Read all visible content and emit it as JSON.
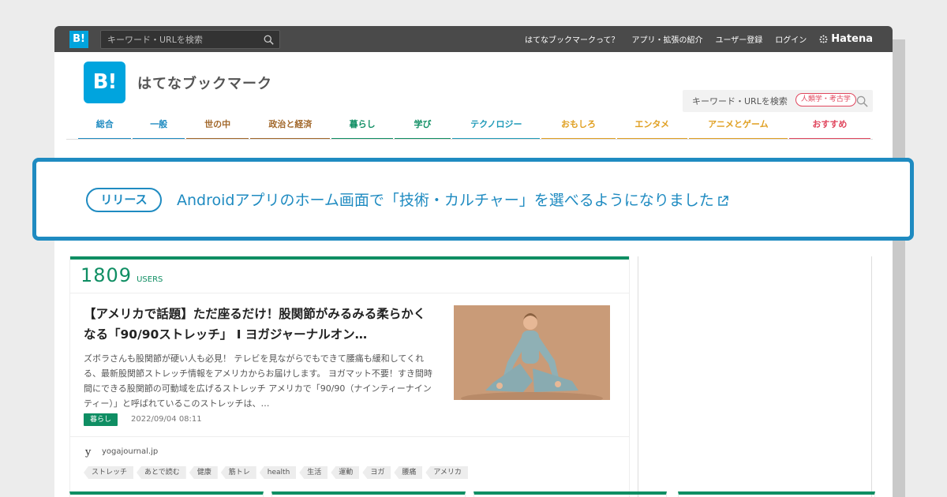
{
  "topbar": {
    "logo": "B!",
    "search_placeholder": "キーワード・URLを検索",
    "nav": [
      "はてなブックマークって？",
      "アプリ・拡張の紹介",
      "ユーザー登録",
      "ログイン"
    ],
    "hatena_logo": "Hatena"
  },
  "header": {
    "logo": "B!",
    "brand": "はてなブックマーク",
    "search_placeholder": "キーワード・URLを検索"
  },
  "categories": [
    {
      "label": "総合",
      "color": "#1f8bc1"
    },
    {
      "label": "一般",
      "color": "#1f8bc1"
    },
    {
      "label": "世の中",
      "color": "#a2682b"
    },
    {
      "label": "政治と経済",
      "color": "#a2682b"
    },
    {
      "label": "暮らし",
      "color": "#0f8e63"
    },
    {
      "label": "学び",
      "color": "#0f8e63"
    },
    {
      "label": "テクノロジー",
      "color": "#1f9ab8"
    },
    {
      "label": "おもしろ",
      "color": "#e0a022"
    },
    {
      "label": "エンタメ",
      "color": "#e0a022"
    },
    {
      "label": "アニメとゲーム",
      "color": "#e0a022"
    },
    {
      "label": "おすすめ",
      "color": "#e0475e"
    }
  ],
  "recommend_badge": "人類学・考古学",
  "announcement": {
    "tag": "リリース",
    "message": "Androidアプリのホーム画面で「技術・カルチャー」を選べるようになりました"
  },
  "entry": {
    "users_count": "1809",
    "users_label": "USERS",
    "title": "【アメリカで話題】ただ座るだけ！股関節がみるみる柔らかくなる「90/90ストレッチ」 I ヨガジャーナルオン…",
    "summary": "ズボラさんも股関節が硬い人も必見！ テレビを見ながらでもできて腰痛も緩和してくれる、最新股関節ストレッチ情報をアメリカからお届けします。 ヨガマット不要！すき間時間にできる股関節の可動域を広げるストレッチ アメリカで「90/90（ナインティーナインティー）」と呼ばれているこのストレッチは、…",
    "category": "暮らし",
    "date": "2022/09/04 08:11",
    "favicon": "y",
    "domain": "yogajournal.jp",
    "tags": [
      "ストレッチ",
      "あとで読む",
      "健康",
      "筋トレ",
      "health",
      "生活",
      "運動",
      "ヨガ",
      "腰痛",
      "アメリカ"
    ]
  }
}
